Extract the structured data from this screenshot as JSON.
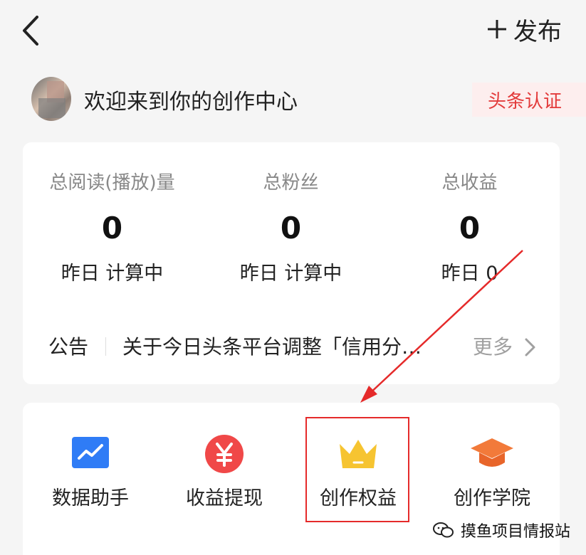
{
  "header": {
    "publish_label": "发布"
  },
  "welcome": {
    "text": "欢迎来到你的创作中心",
    "verify_badge": "头条认证"
  },
  "stats": [
    {
      "label": "总阅读(播放)量",
      "value": "0",
      "sub": "昨日 计算中"
    },
    {
      "label": "总粉丝",
      "value": "0",
      "sub": "昨日 计算中"
    },
    {
      "label": "总收益",
      "value": "0",
      "sub": "昨日 0"
    }
  ],
  "notice": {
    "tag": "公告",
    "text": "关于今日头条平台调整「信用分…",
    "more": "更多"
  },
  "tools": [
    {
      "label": "数据助手",
      "icon": "data-chart-icon",
      "color": "#2f7cf6"
    },
    {
      "label": "收益提现",
      "icon": "yuan-coin-icon",
      "color": "#f04848"
    },
    {
      "label": "创作权益",
      "icon": "crown-icon",
      "color": "#f6c431"
    },
    {
      "label": "创作学院",
      "icon": "graduation-cap-icon",
      "color": "#f27a3a"
    }
  ],
  "annotation": {
    "highlight_color": "#e52a2a"
  },
  "watermark": {
    "text": "摸鱼项目情报站"
  }
}
